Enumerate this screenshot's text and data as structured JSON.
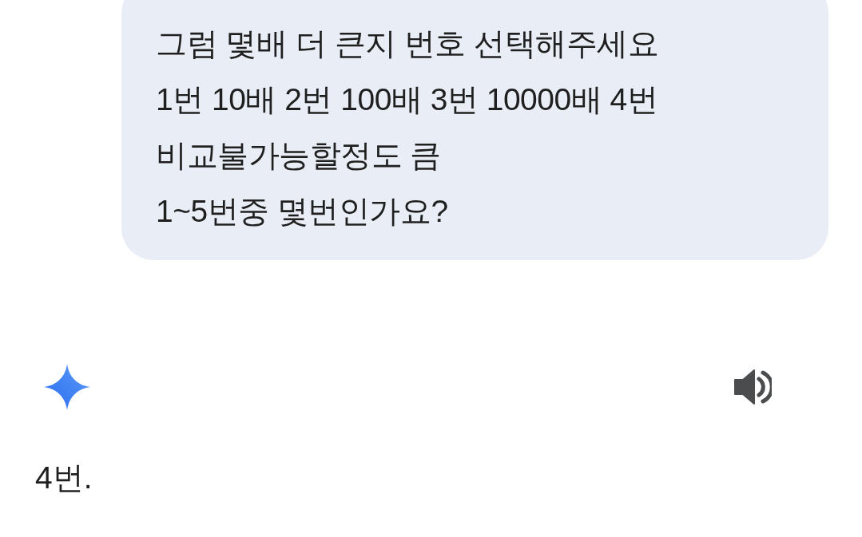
{
  "user_message": {
    "text": "그럼 몇배 더 큰지 번호 선택해주세요\n1번 10배 2번 100배 3번 10000배 4번\n비교불가능할정도 큼\n1~5번중 몇번인가요?"
  },
  "response": {
    "text": "4번."
  }
}
